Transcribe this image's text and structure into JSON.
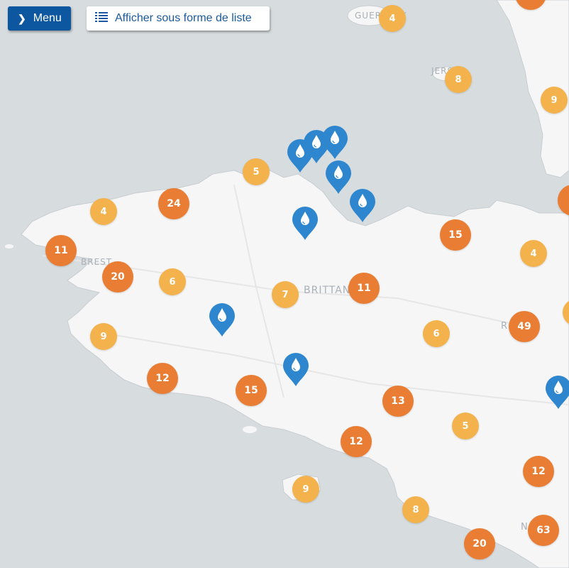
{
  "toolbar": {
    "menu_label": "Menu",
    "menu_icon": "chevron-right-icon",
    "list_label": "Afficher sous forme de liste",
    "list_icon": "list-icon"
  },
  "colors": {
    "water": "#d7dcdf",
    "land": "#f6f6f6",
    "cluster_large": "#e97d33",
    "cluster_small": "#f3b24b",
    "marker": "#2e86cf",
    "button_primary": "#0d57a0"
  },
  "map": {
    "place_labels": {
      "guernsey": "GUERNSEY",
      "jersey": "JERSEY",
      "brest": "BREST",
      "brittany": "BRITTANY",
      "rennes": "R",
      "nantes": "N"
    },
    "clusters": [
      {
        "count": "4",
        "tier": "yellow"
      },
      {
        "count": "8",
        "tier": "yellow"
      },
      {
        "count": "9",
        "tier": "yellow"
      },
      {
        "count": "5",
        "tier": "yellow"
      },
      {
        "count": "4",
        "tier": "yellow"
      },
      {
        "count": "24",
        "tier": "orange"
      },
      {
        "count": "11",
        "tier": "orange"
      },
      {
        "count": "20",
        "tier": "orange"
      },
      {
        "count": "6",
        "tier": "yellow"
      },
      {
        "count": "7",
        "tier": "yellow"
      },
      {
        "count": "11",
        "tier": "orange"
      },
      {
        "count": "15",
        "tier": "orange"
      },
      {
        "count": "4",
        "tier": "yellow"
      },
      {
        "count": "9",
        "tier": "yellow"
      },
      {
        "count": "6",
        "tier": "yellow"
      },
      {
        "count": "49",
        "tier": "orange"
      },
      {
        "count": "12",
        "tier": "orange"
      },
      {
        "count": "15",
        "tier": "orange"
      },
      {
        "count": "13",
        "tier": "orange"
      },
      {
        "count": "5",
        "tier": "yellow"
      },
      {
        "count": "12",
        "tier": "orange"
      },
      {
        "count": "12",
        "tier": "orange"
      },
      {
        "count": "9",
        "tier": "yellow"
      },
      {
        "count": "8",
        "tier": "yellow"
      },
      {
        "count": "20",
        "tier": "orange"
      },
      {
        "count": "63",
        "tier": "orange"
      }
    ],
    "markers_icon": "water-drop-icon"
  }
}
